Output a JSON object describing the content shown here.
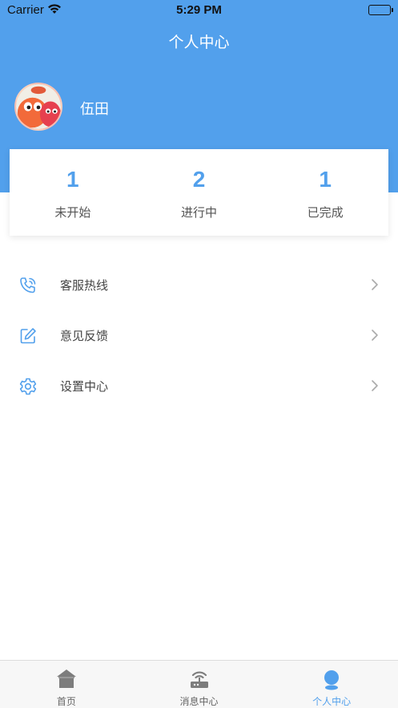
{
  "status_bar": {
    "carrier": "Carrier",
    "time": "5:29 PM"
  },
  "nav": {
    "title": "个人中心"
  },
  "profile": {
    "name": "伍田"
  },
  "stats": [
    {
      "value": "1",
      "label": "未开始"
    },
    {
      "value": "2",
      "label": "进行中"
    },
    {
      "value": "1",
      "label": "已完成"
    }
  ],
  "menu": [
    {
      "label": "客服热线",
      "icon": "phone-icon"
    },
    {
      "label": "意见反馈",
      "icon": "edit-icon"
    },
    {
      "label": "设置中心",
      "icon": "gear-icon"
    }
  ],
  "tabbar": [
    {
      "label": "首页",
      "icon": "home-icon",
      "active": false
    },
    {
      "label": "消息中心",
      "icon": "router-icon",
      "active": false
    },
    {
      "label": "个人中心",
      "icon": "user-icon",
      "active": true
    }
  ],
  "colors": {
    "accent": "#52a0ec",
    "header_bg": "#52a0ec",
    "tab_inactive": "#666666"
  }
}
